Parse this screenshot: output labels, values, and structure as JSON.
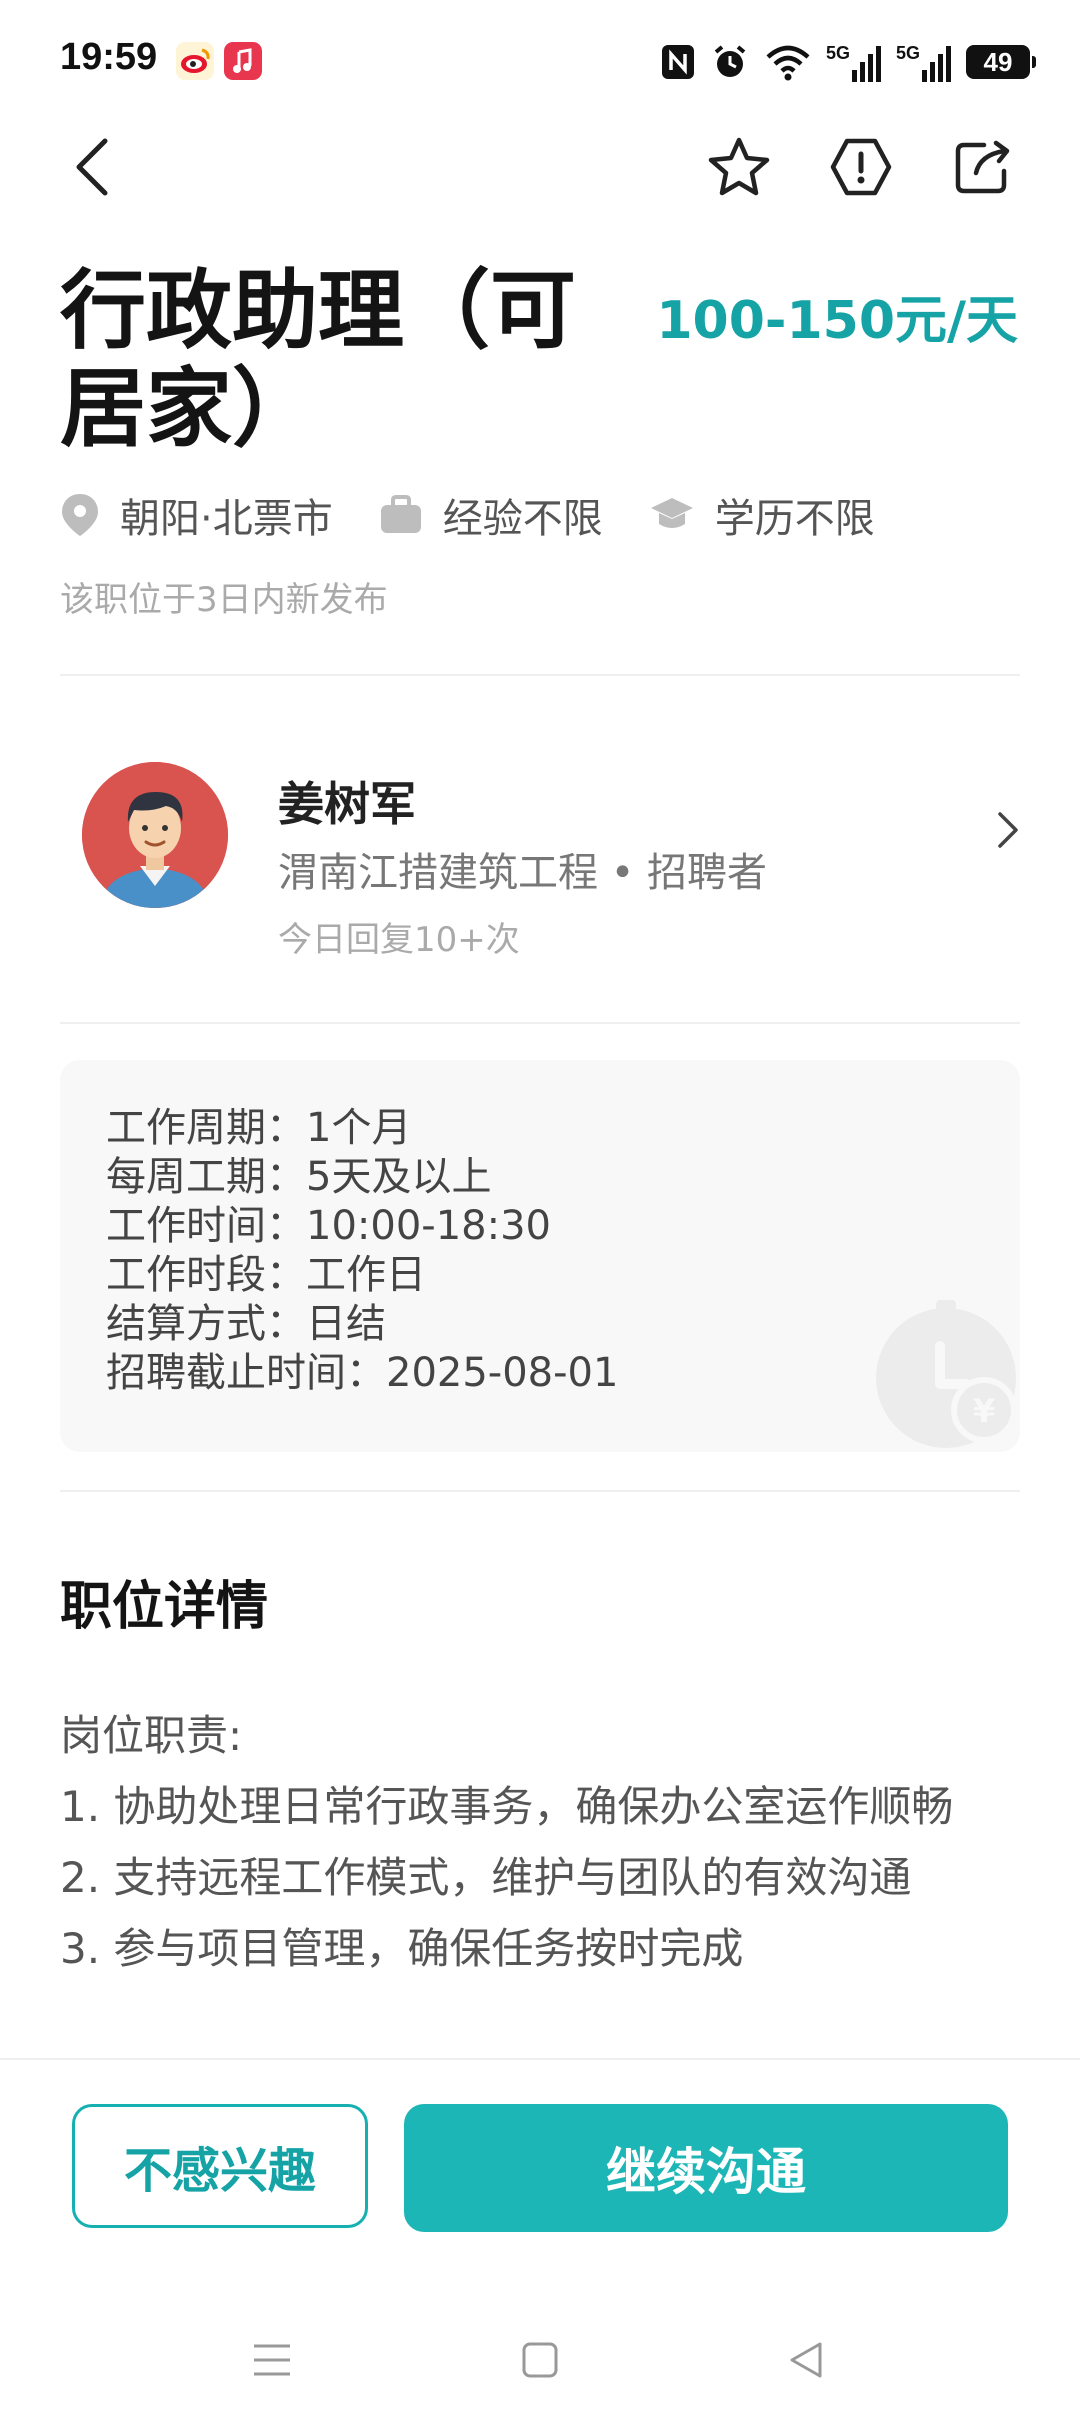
{
  "status_bar": {
    "time": "19:59",
    "apps": [
      "weibo-icon",
      "music-icon"
    ],
    "network1": "5G",
    "network2": "5G",
    "battery": "49"
  },
  "job": {
    "title": "行政助理（可居家）",
    "salary": "100-150元/天",
    "location": "朝阳·北票市",
    "experience": "经验不限",
    "education": "学历不限",
    "posted": "该职位于3日内新发布"
  },
  "recruiter": {
    "name": "姜树军",
    "company": "渭南江措建筑工程 • 招聘者",
    "reply": "今日回复10+次"
  },
  "info": {
    "lines": [
      "工作周期：1个月",
      "每周工期：5天及以上",
      "工作时间：10:00-18:30",
      "工作时段：工作日",
      "结算方式：日结",
      "招聘截止时间：2025-08-01"
    ]
  },
  "details": {
    "title": "职位详情",
    "lines": [
      "岗位职责:",
      "1. 协助处理日常行政事务，确保办公室运作顺畅",
      "2. 支持远程工作模式，维护与团队的有效沟通",
      "3. 参与项目管理，确保任务按时完成"
    ]
  },
  "actions": {
    "not_interested": "不感兴趣",
    "continue_chat": "继续沟通"
  },
  "colors": {
    "accent": "#1db6b6",
    "salary": "#16a3a6"
  }
}
